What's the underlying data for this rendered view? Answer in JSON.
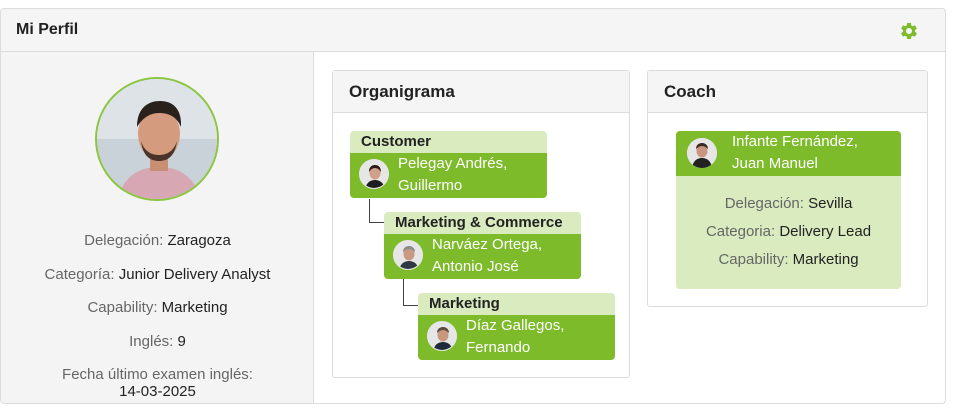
{
  "header": {
    "title": "Mi Perfil",
    "settings_icon": "gear-icon",
    "accent_color": "#7dbb2a"
  },
  "profile": {
    "avatar_alt": "profile-photo",
    "fields": [
      {
        "label": "Delegación:",
        "value": "Zaragoza"
      },
      {
        "label": "Categoría:",
        "value": "Junior Delivery Analyst"
      },
      {
        "label": "Capability:",
        "value": "Marketing"
      },
      {
        "label": "Inglés:",
        "value": "9"
      }
    ],
    "exam": {
      "label": "Fecha último examen inglés:",
      "value": "14-03-2025"
    }
  },
  "organigrama": {
    "title": "Organigrama",
    "nodes": [
      {
        "group": "Customer",
        "name_line1": "Pelegay Andrés,",
        "name_line2": "Guillermo"
      },
      {
        "group": "Marketing & Commerce",
        "name_line1": "Narváez Ortega,",
        "name_line2": "Antonio José"
      },
      {
        "group": "Marketing",
        "name_line1": "Díaz Gallegos,",
        "name_line2": "Fernando"
      }
    ]
  },
  "coach": {
    "title": "Coach",
    "name_line1": "Infante Fernández,",
    "name_line2": "Juan Manuel",
    "fields": [
      {
        "label": "Delegación:",
        "value": "Sevilla"
      },
      {
        "label": "Categoria:",
        "value": "Delivery Lead"
      },
      {
        "label": "Capability:",
        "value": "Marketing"
      }
    ]
  }
}
